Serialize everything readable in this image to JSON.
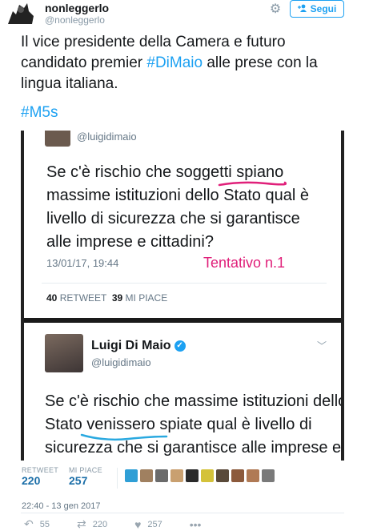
{
  "header": {
    "display_name": "nonleggerlo",
    "handle": "@nonleggerlo",
    "follow_label": "Segui",
    "follow_icon": "add-user-icon",
    "settings_icon": "gear-icon"
  },
  "tweet": {
    "text_before": "Il vice presidente della Camera e futuro candidato premier ",
    "hashtag_inline": "#DiMaio",
    "text_after": " alle prese con la lingua italiana.",
    "hashtag_footer": "#M5s"
  },
  "embedded_image": {
    "card1": {
      "handle": "@luigidimaio",
      "text_pre": "Se c'è rischio che soggetti ",
      "text_hl": "spiano",
      "text_post": " massime istituzioni dello Stato qual è livello di sicurezza che si garantisce alle imprese e cittadini?",
      "date": "13/01/17, 19:44",
      "annotation": "Tentativo n.1",
      "annotation_color": "#e0207a",
      "retweets_num": "40",
      "retweets_label": "RETWEET",
      "likes_num": "39",
      "likes_label": "MI PIACE"
    },
    "card2": {
      "name": "Luigi Di Maio",
      "handle": "@luigidimaio",
      "line1": "Se c'è rischio che massime istituzioni dello",
      "line2_pre": "Stato ",
      "line2_hl": "venissero",
      "line2_post": " spiate qual è livello di",
      "line3": "sicurezza che si garantisce alle imprese e",
      "underline_color": "#2aa9e0"
    }
  },
  "stats": {
    "retweet_label": "RETWEET",
    "retweet_count": "220",
    "likes_label": "MI PIACE",
    "likes_count": "257"
  },
  "timestamp": "22:40 - 13 gen 2017",
  "actions": {
    "reply_count": "55",
    "retweet_count": "220",
    "like_count": "257"
  },
  "colors": {
    "link_blue": "#1da1f2",
    "stat_blue": "#1b6ea8",
    "muted": "#8899a6"
  }
}
